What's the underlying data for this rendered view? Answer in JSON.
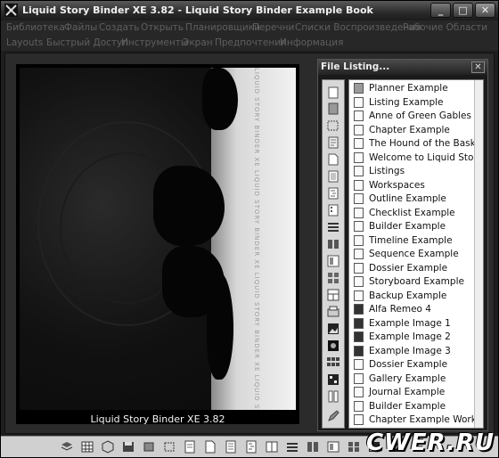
{
  "window": {
    "title": "Liquid Story Binder XE 3.82 - Liquid Story Binder Example Book",
    "buttons": {
      "minimize": "_",
      "maximize": "□",
      "close": "✕"
    }
  },
  "menu_row1": [
    "Библиотека",
    "Файлы",
    "Создать",
    "Открыть",
    "Планировщики",
    "Перечни",
    "Списки Воспроизведения",
    "Рабочие Области"
  ],
  "menu_row2": [
    "Layouts",
    "Быстрый Доступ",
    "Инструменты",
    "Экран",
    "Предпочтения",
    "Информация"
  ],
  "cover": {
    "caption": "Liquid Story Binder XE 3.82",
    "spine_text": "LIQUID STORY BINDER XE LIQUID STORY BINDER XE LIQUID STORY BINDER XE LIQUID STORY BINDER XE LIQUID STORY BINDER XE"
  },
  "file_listing": {
    "title": "File Listing...",
    "close": "✕",
    "items": [
      "Planner Example",
      "Listing Example",
      "Anne of Green Gables",
      "Chapter Example",
      "The Hound of the Baskerv",
      "Welcome to Liquid Story B",
      "Listings",
      "Workspaces",
      "Outline Example",
      "Checklist Example",
      "Builder Example",
      "Timeline Example",
      "Sequence Example",
      "Dossier Example",
      "Storyboard Example",
      "Backup Example",
      "Alfa Remeo 4",
      "Example Image 1",
      "Example Image 2",
      "Example Image 3",
      "Dossier Example",
      "Gallery Example",
      "Journal Example",
      "Builder Example",
      "Chapter Example Workspa"
    ]
  },
  "watermark": "CWER.RU",
  "colors": {
    "title_bar": "#2a2a2a",
    "menu_text": "#5f5f5f",
    "list_bg": "#ffffff",
    "toolbar_bg": "#d0d0d0"
  }
}
